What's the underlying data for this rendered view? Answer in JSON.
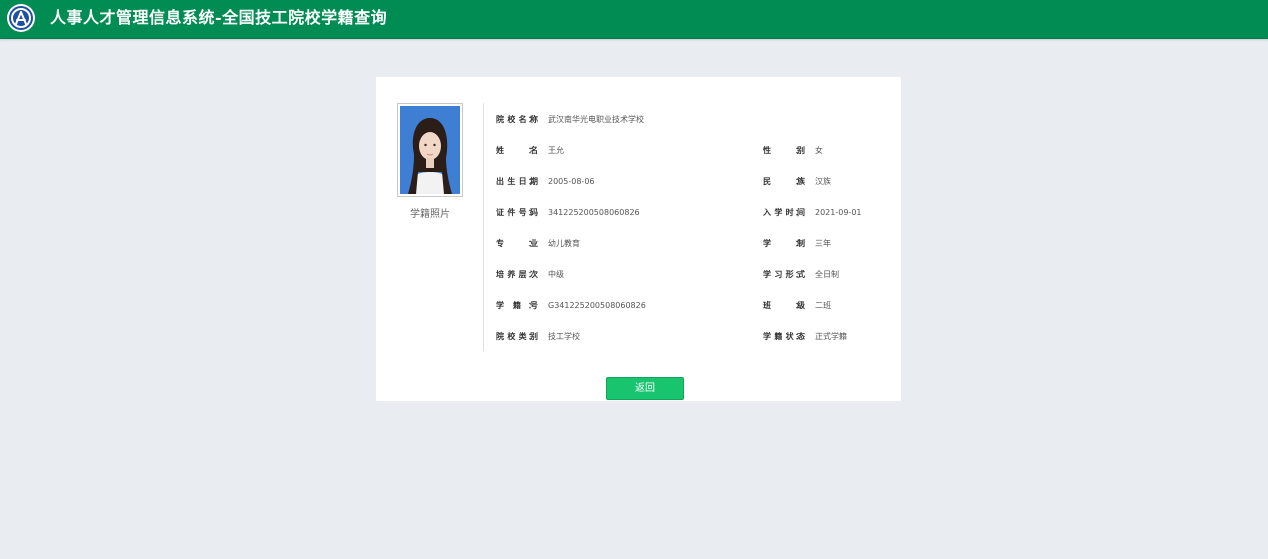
{
  "app": {
    "title": "人事人才管理信息系统-全国技工院校学籍查询"
  },
  "photo": {
    "caption": "学籍照片"
  },
  "fields": {
    "school_name": {
      "label": "院校名称",
      "value": "武汉南华光电职业技术学校"
    },
    "name": {
      "label": "姓名",
      "value": "王允"
    },
    "gender": {
      "label": "性别",
      "value": "女"
    },
    "birth_date": {
      "label": "出生日期",
      "value": "2005-08-06"
    },
    "ethnicity": {
      "label": "民族",
      "value": "汉族"
    },
    "id_number": {
      "label": "证件号码",
      "value": "341225200508060826"
    },
    "enroll_date": {
      "label": "入学时间",
      "value": "2021-09-01"
    },
    "major": {
      "label": "专业",
      "value": "幼儿教育"
    },
    "duration": {
      "label": "学制",
      "value": "三年"
    },
    "level": {
      "label": "培养层次",
      "value": "中级"
    },
    "study_form": {
      "label": "学习形式",
      "value": "全日制"
    },
    "student_no": {
      "label": "学籍号",
      "value": "G341225200508060826"
    },
    "class": {
      "label": "班级",
      "value": "二班"
    },
    "school_type": {
      "label": "院校类别",
      "value": "技工学校"
    },
    "status": {
      "label": "学籍状态",
      "value": "正式学籍"
    }
  },
  "colon": "：",
  "actions": {
    "back_label": "返回"
  },
  "colors": {
    "header": "#008c52",
    "button": "#19c46f",
    "background": "#e9edf1"
  }
}
